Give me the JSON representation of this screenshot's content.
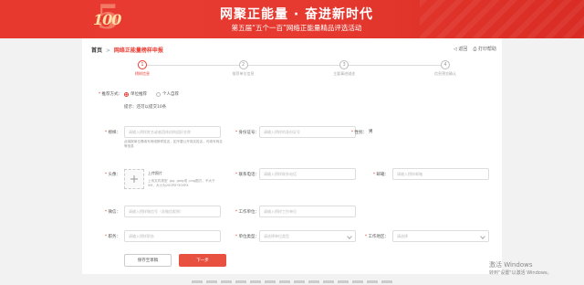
{
  "banner": {
    "logo_number": "100",
    "logo_five": "5",
    "title": "网聚正能量 · 奋进新时代",
    "subtitle": "第五届“五个一百”网络正能量精品评选活动"
  },
  "breadcrumb": {
    "home": "首页",
    "separator": ">",
    "current": "网络正能量榜样申报"
  },
  "top_actions": {
    "back": "◁ 返回",
    "print": "⎙ 打印帮助"
  },
  "steps": [
    {
      "number": "1",
      "label": "榜样信息",
      "active": true
    },
    {
      "number": "2",
      "label": "推荐单位信息",
      "active": false
    },
    {
      "number": "3",
      "label": "主要事迹描述",
      "active": false
    },
    {
      "number": "4",
      "label": "信息预览确认",
      "active": false
    }
  ],
  "form": {
    "recommend_method_label": "推荐方式：",
    "method_options": [
      "单位推荐",
      "个人自荐"
    ],
    "method_selected": "单位推荐",
    "hint": "提示：还可以提交10条",
    "name_label": "榜样：",
    "name_placeholder": "请输入榜样姓名或者团体机构组织名称",
    "name_note": "此填报单位需填写网络榜样姓名，如不要公开真实姓名，可填写网名等信息",
    "id_label": "身份证号：",
    "id_placeholder": "请输入榜样的身份证号",
    "gender_label": "性别：",
    "gender_value": "男",
    "avatar_label": "头像：",
    "upload_text": "上传照片",
    "upload_tip": "上传文件类型 .jpg .jpeg或 .png图式，不大于5M，大小为200PX*300PX",
    "phone_label": "联系电话：",
    "phone_placeholder": "请输入榜样联系电话",
    "email_label": "邮箱：",
    "email_placeholder": "请输入榜样邮箱",
    "wechat_label": "微信：",
    "wechat_placeholder": "请输入榜样微信号（非微信昵称）",
    "org_label": "工作单位：",
    "org_placeholder": "请输入榜样工作单位",
    "title_label": "职务：",
    "title_placeholder": "请输入榜样职务",
    "org_type_label": "单位类型：",
    "org_type_placeholder": "请选择单位类型",
    "region_label": "工作地区：",
    "region_placeholder": "请选择"
  },
  "buttons": {
    "save_draft": "保存至草稿",
    "next": "下一步"
  },
  "watermark": {
    "line1": "激活 Windows",
    "line2": "转到\"设置\"以激活 Windows。"
  },
  "colors": {
    "brand_red": "#e8392f",
    "button_red": "#e8503f"
  }
}
